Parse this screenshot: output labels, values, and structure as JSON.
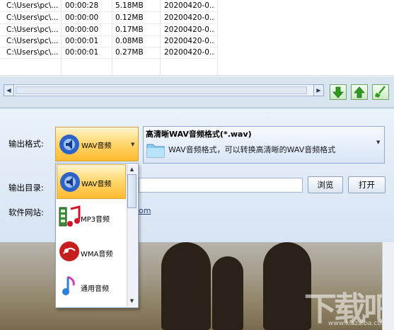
{
  "files": [
    {
      "path": "C:\\Users\\pc\\...",
      "duration": "00:00:28",
      "size": "5.18MB",
      "date": "20200420-0..."
    },
    {
      "path": "C:\\Users\\pc\\...",
      "duration": "00:00:00",
      "size": "0.12MB",
      "date": "20200420-0..."
    },
    {
      "path": "C:\\Users\\pc\\...",
      "duration": "00:00:00",
      "size": "0.17MB",
      "date": "20200420-0..."
    },
    {
      "path": "C:\\Users\\pc\\...",
      "duration": "00:00:01",
      "size": "0.08MB",
      "date": "20200420-0..."
    },
    {
      "path": "C:\\Users\\pc\\...",
      "duration": "00:00:01",
      "size": "0.27MB",
      "date": "20200420-0..."
    }
  ],
  "scroll": {
    "left_arrow": "◀",
    "right_arrow": "▶"
  },
  "actions": {
    "move_down_icon": "arrow-down",
    "move_up_icon": "arrow-up",
    "clear_icon": "broom"
  },
  "format": {
    "label": "输出格式:",
    "selected": "WAV音频",
    "title": "高清晰WAV音频格式(*.wav)",
    "description": "WAV音频格式，可以转换高清晰的WAV音频格式",
    "options": [
      "WAV音频",
      "MP3音频",
      "WMA音频",
      "通用音频"
    ]
  },
  "output": {
    "label": "输出目录:",
    "path": "",
    "browse_label": "浏览",
    "open_label": "打开"
  },
  "website": {
    "label": "软件网站:",
    "url_fragment": "om"
  },
  "watermark": {
    "text": "下载吧",
    "small": "www.xiazaiba.com"
  },
  "colors": {
    "selection": "#ffd66a",
    "panel": "#dde8f5",
    "green_button": "#3aa52a"
  }
}
